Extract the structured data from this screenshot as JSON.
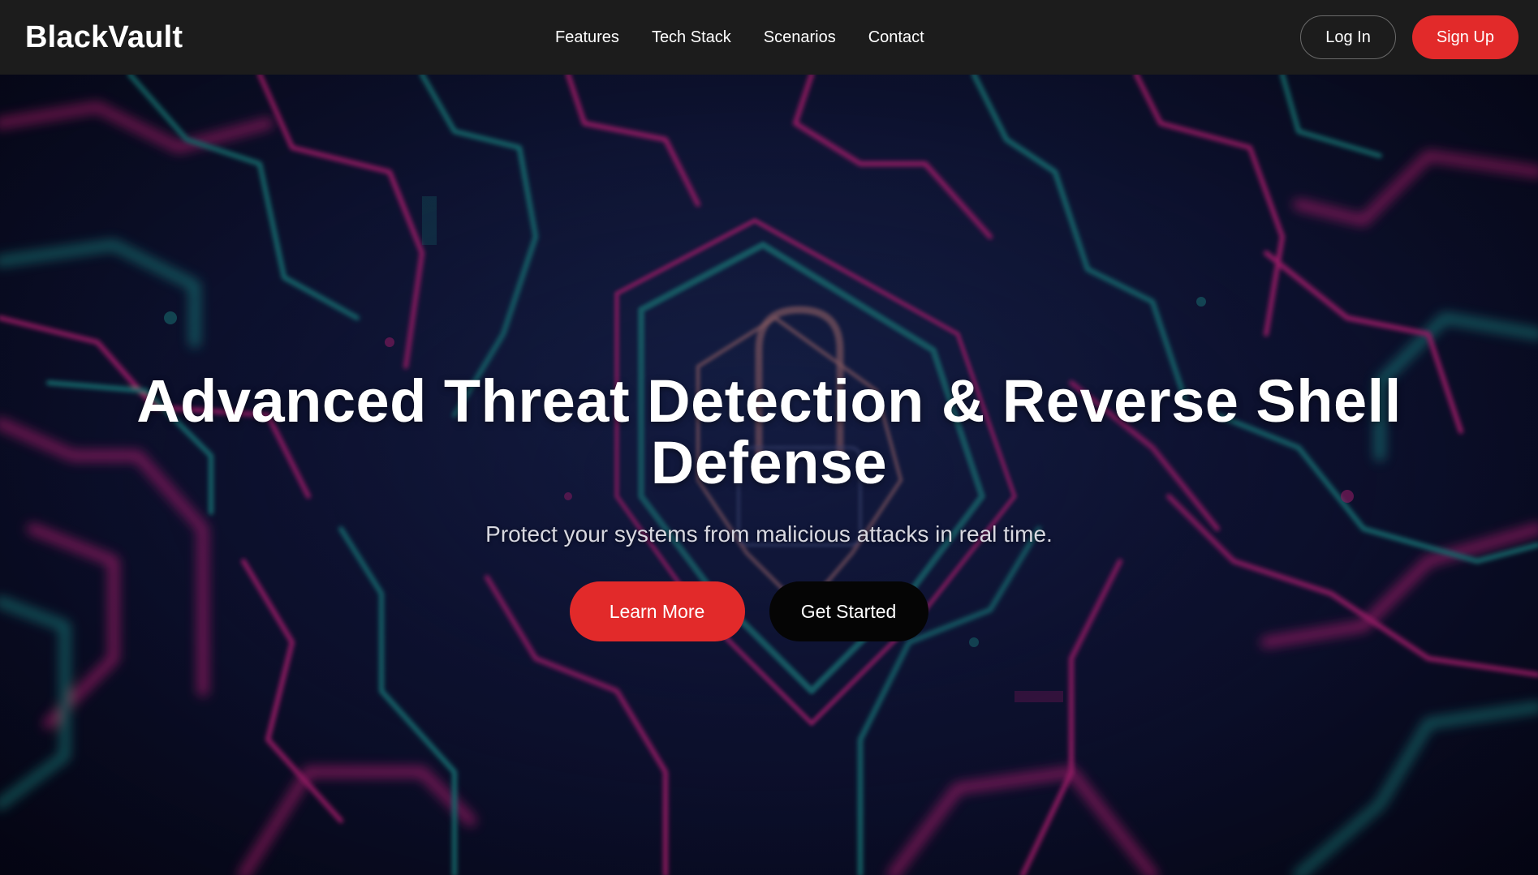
{
  "header": {
    "brand": "BlackVault",
    "nav": [
      {
        "label": "Features"
      },
      {
        "label": "Tech Stack"
      },
      {
        "label": "Scenarios"
      },
      {
        "label": "Contact"
      }
    ],
    "login_label": "Log In",
    "signup_label": "Sign Up"
  },
  "hero": {
    "title": "Advanced Threat Detection & Reverse Shell Defense",
    "subtitle": "Protect your systems from malicious attacks in real time.",
    "learn_more_label": "Learn More",
    "get_started_label": "Get Started",
    "background_icon": "padlock-shield-circuit-icon"
  },
  "colors": {
    "accent": "#e22a2a",
    "navbar": "#1c1c1c",
    "circuit_magenta": "#c2247e",
    "circuit_teal": "#1f8a8a",
    "hero_dark": "#0b0d28"
  }
}
